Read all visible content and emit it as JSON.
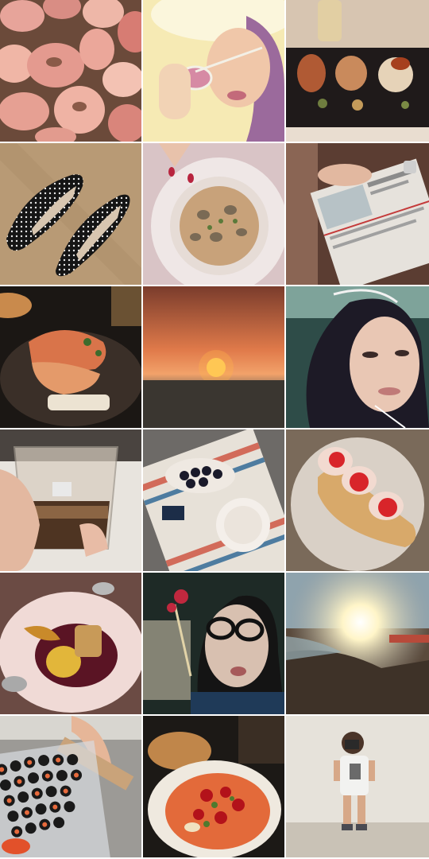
{
  "collage": {
    "rows": 6,
    "columns": 3,
    "tiles": [
      {
        "subject": "peaches-icon"
      },
      {
        "subject": "woman-sunglasses-icon"
      },
      {
        "subject": "seared-scallops-icon"
      },
      {
        "subject": "polka-dot-flats-icon"
      },
      {
        "subject": "clam-pasta-icon"
      },
      {
        "subject": "clipboard-menu-icon"
      },
      {
        "subject": "prawn-dish-icon"
      },
      {
        "subject": "sunset-icon"
      },
      {
        "subject": "selfie-icon"
      },
      {
        "subject": "espresso-glass-icon"
      },
      {
        "subject": "sushi-table-icon"
      },
      {
        "subject": "tomato-toast-icon"
      },
      {
        "subject": "dessert-plate-icon"
      },
      {
        "subject": "woman-glasses-flower-icon"
      },
      {
        "subject": "beach-sun-icon"
      },
      {
        "subject": "sushi-tray-icon"
      },
      {
        "subject": "tomato-salad-icon"
      },
      {
        "subject": "child-camera-icon"
      }
    ]
  }
}
